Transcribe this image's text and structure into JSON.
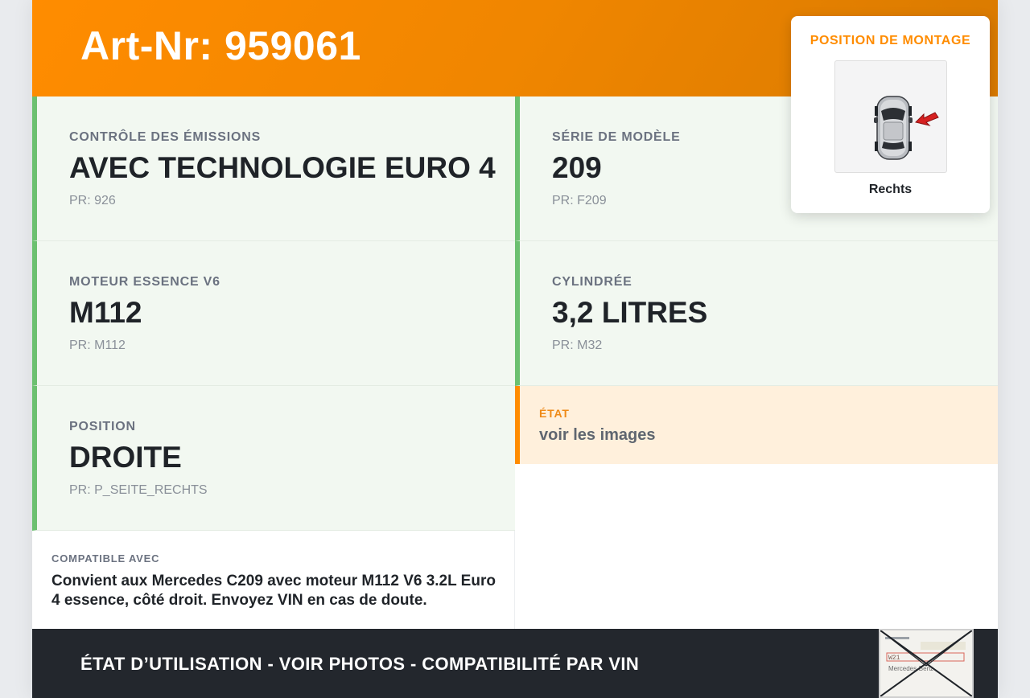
{
  "header": {
    "title": "Art-Nr: 959061"
  },
  "specs": [
    {
      "label": "CONTRÔLE DES ÉMISSIONS",
      "value": "AVEC TECHNOLOGIE EURO 4",
      "pr": "PR: 926"
    },
    {
      "label": "SÉRIE DE MODÈLE",
      "value": "209",
      "pr": "PR: F209"
    },
    {
      "label": "MOTEUR ESSENCE V6",
      "value": "M112",
      "pr": "PR: M112"
    },
    {
      "label": "CYLINDRÉE",
      "value": "3,2 LITRES",
      "pr": "PR: M32"
    },
    {
      "label": "POSITION",
      "value": "DROITE",
      "pr": "PR: P_SEITE_RECHTS"
    }
  ],
  "etat": {
    "label": "ÉTAT",
    "value": "voir les images"
  },
  "compat": {
    "label": "COMPATIBLE AVEC",
    "text": "Convient aux Mercedes C209 avec moteur M112 V6 3.2L Euro 4 essence, côté droit. Envoyez VIN en cas de doute."
  },
  "footer": {
    "text": "ÉTAT D’UTILISATION - VOIR PHOTOS - COMPATIBILITÉ PAR VIN",
    "stamp_text": [
      "W21",
      "Mercedes-Benz"
    ]
  },
  "mounting_popup": {
    "title": "POSITION DE MONTAGE",
    "caption": "Rechts",
    "icon": "car-top-view-icon",
    "arrow_icon": "arrow-pointer-icon"
  },
  "colors": {
    "accent_orange": "#ff8c00",
    "green_border": "#6cc070",
    "cell_bg": "#f2f8f1",
    "etat_bg": "#fff0dc",
    "footer_bg": "#23272d",
    "arrow_red": "#d62020"
  }
}
